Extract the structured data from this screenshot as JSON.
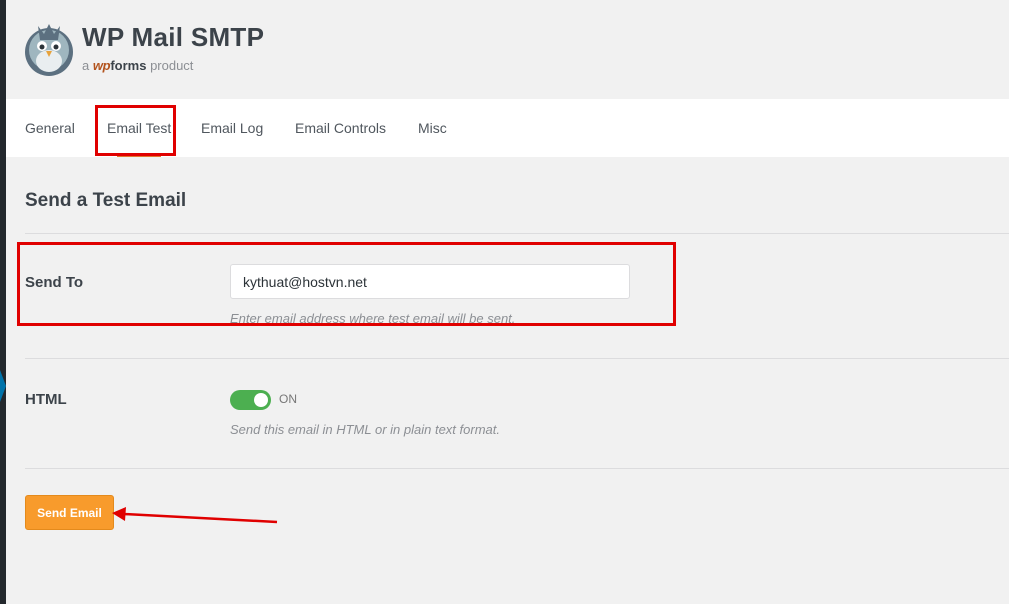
{
  "brand": {
    "title": "WP Mail SMTP",
    "sub_prefix": "a",
    "sub_wp": "wp",
    "sub_forms": "forms",
    "sub_suffix": "product"
  },
  "tabs": [
    {
      "label": "General",
      "active": false
    },
    {
      "label": "Email Test",
      "active": true
    },
    {
      "label": "Email Log",
      "active": false
    },
    {
      "label": "Email Controls",
      "active": false
    },
    {
      "label": "Misc",
      "active": false
    }
  ],
  "page": {
    "section_title": "Send a Test Email",
    "send_to": {
      "label": "Send To",
      "value": "kythuat@hostvn.net",
      "help": "Enter email address where test email will be sent."
    },
    "html": {
      "label": "HTML",
      "toggle_on": true,
      "toggle_state": "ON",
      "help": "Send this email in HTML or in plain text format."
    },
    "send_button": "Send Email"
  },
  "colors": {
    "accent_orange": "#f89b2c",
    "toggle_green": "#4caf50",
    "annotation_red": "#e00000",
    "admin_bar": "#23282d"
  },
  "icons": {
    "logo": "pigeon-mascot-icon",
    "annotation_arrow": "red-arrow-icon"
  }
}
